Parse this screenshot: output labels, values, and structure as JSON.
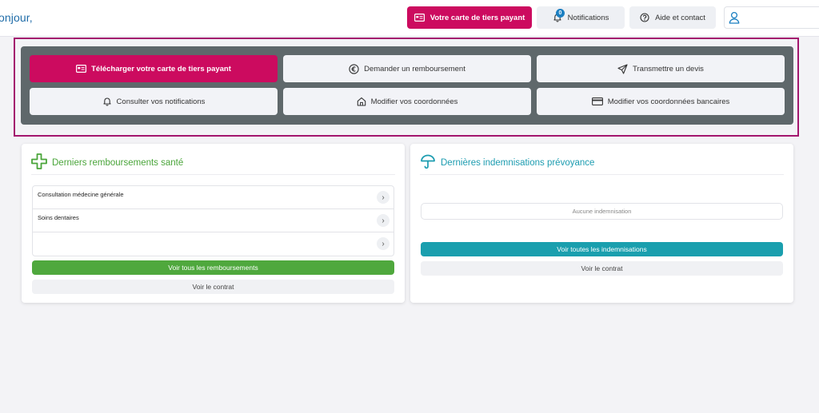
{
  "header": {
    "greeting": "onjour,",
    "card_button": {
      "label": "Votre carte de tiers payant",
      "icon": "card-icon"
    },
    "notifications_button": {
      "label": "Notifications",
      "icon": "bell-icon",
      "count": "0"
    },
    "help_button": {
      "label": "Aide et contact",
      "icon": "question-icon"
    },
    "user_button": {
      "icon": "user-icon"
    }
  },
  "quick_actions": [
    {
      "label": "Télécharger votre carte de tiers payant",
      "icon": "card-icon"
    },
    {
      "label": "Demander un remboursement",
      "icon": "euro-icon"
    },
    {
      "label": "Transmettre un devis",
      "icon": "send-icon"
    },
    {
      "label": "Consulter vos notifications",
      "icon": "bell-icon"
    },
    {
      "label": "Modifier vos coordonnées",
      "icon": "home-icon"
    },
    {
      "label": "Modifier vos coordonnées bancaires",
      "icon": "credit-card-icon"
    }
  ],
  "health_card": {
    "title": "Derniers remboursements santé",
    "icon": "plus-icon",
    "rows": [
      "Consultation médecine générale",
      "Soins dentaires",
      ""
    ],
    "primary_button": "Voir tous les remboursements",
    "secondary_button": "Voir le contrat"
  },
  "provident_card": {
    "title": "Dernières indemnisations prévoyance",
    "icon": "umbrella-icon",
    "empty_text": "Aucune indemnisation",
    "primary_button": "Voir toutes les indemnisations",
    "secondary_button": "Voir le contrat"
  },
  "colors": {
    "brand": "#cc0b5f",
    "health": "#4fa83d",
    "provident": "#1a9fae",
    "panel": "#5f686b",
    "frame": "#a3166e"
  }
}
